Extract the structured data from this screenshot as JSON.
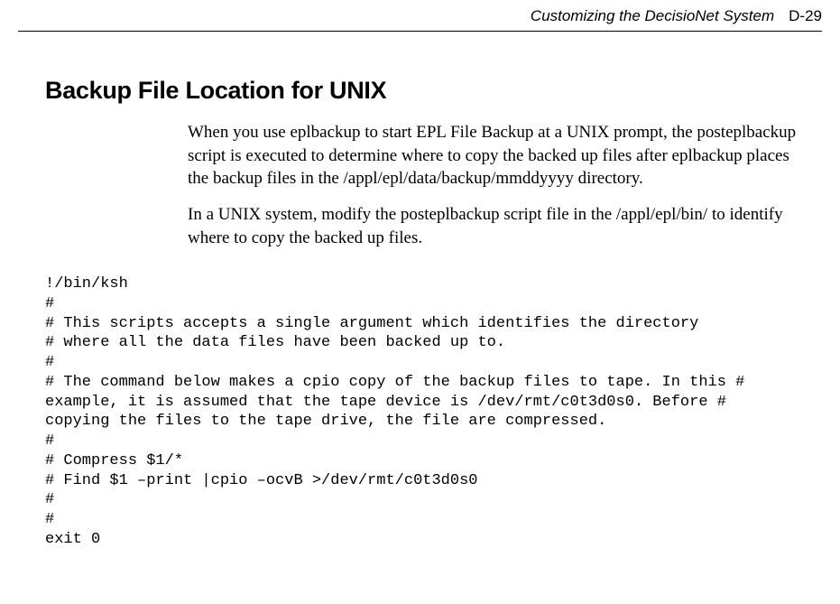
{
  "header": {
    "title": "Customizing the DecisioNet System",
    "page": "D-29"
  },
  "heading": "Backup File Location for UNIX",
  "para1": "When you use eplbackup to start EPL File Backup at a UNIX prompt, the posteplbackup script is executed to determine where to copy the backed up files after eplbackup places the backup files in the /appl/epl/data/backup/mmddyyyy directory.",
  "para2": "In a UNIX system, modify the posteplbackup script file in the /appl/epl/bin/ to identify where to copy the backed up files.",
  "code": "!/bin/ksh\n#\n# This scripts accepts a single argument which identifies the directory\n# where all the data files have been backed up to.\n#\n# The command below makes a cpio copy of the backup files to tape. In this #\nexample, it is assumed that the tape device is /dev/rmt/c0t3d0s0. Before #\ncopying the files to the tape drive, the file are compressed.\n#\n# Compress $1/*\n# Find $1 –print |cpio –ocvB >/dev/rmt/c0t3d0s0\n#\n#\nexit 0"
}
